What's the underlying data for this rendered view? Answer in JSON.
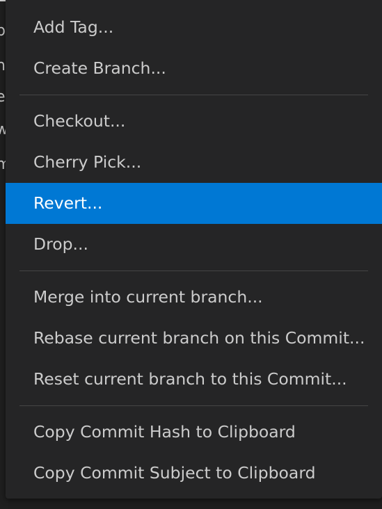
{
  "background_peek": [
    "p",
    "n",
    "e",
    "w",
    "m"
  ],
  "context_menu": {
    "groups": [
      [
        {
          "label": "Add Tag...",
          "active": false
        },
        {
          "label": "Create Branch...",
          "active": false
        }
      ],
      [
        {
          "label": "Checkout...",
          "active": false
        },
        {
          "label": "Cherry Pick...",
          "active": false
        },
        {
          "label": "Revert...",
          "active": true
        },
        {
          "label": "Drop...",
          "active": false
        }
      ],
      [
        {
          "label": "Merge into current branch...",
          "active": false
        },
        {
          "label": "Rebase current branch on this Commit...",
          "active": false
        },
        {
          "label": "Reset current branch to this Commit...",
          "active": false
        }
      ],
      [
        {
          "label": "Copy Commit Hash to Clipboard",
          "active": false
        },
        {
          "label": "Copy Commit Subject to Clipboard",
          "active": false
        }
      ]
    ]
  },
  "colors": {
    "menu_background": "#252526",
    "active_background": "#0078d4",
    "text": "#cccccc",
    "active_text": "#ffffff",
    "separator": "#454545"
  }
}
